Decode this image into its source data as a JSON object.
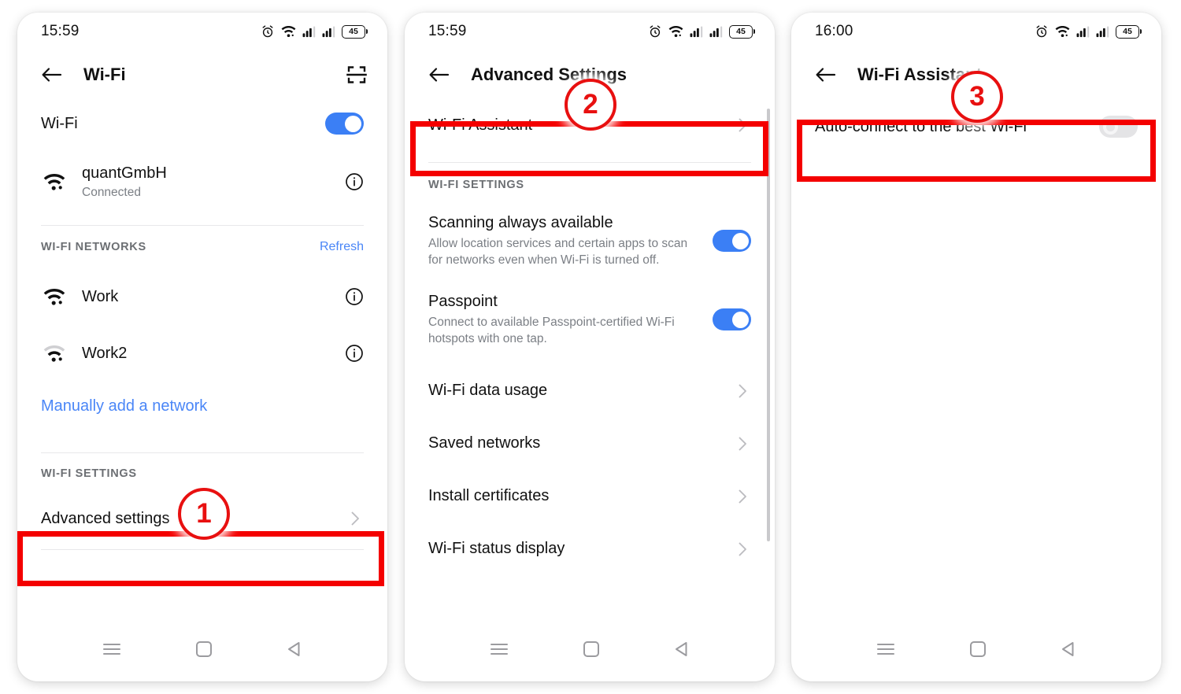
{
  "accent_blue": "#3b7ff5",
  "link_blue": "#4a86f7",
  "highlight_red": "#f40000",
  "panels": [
    {
      "status": {
        "time": "15:59",
        "battery": "45"
      },
      "appbar": {
        "title": "Wi-Fi",
        "back_icon": "arrow-left-icon",
        "action_icon": "qr-scan-icon"
      },
      "wifi_toggle_label": "Wi-Fi",
      "wifi_toggle_state": "on",
      "connected": {
        "ssid": "quantGmbH",
        "status": "Connected",
        "info_icon": "info-icon"
      },
      "networks_header": "WI-FI NETWORKS",
      "refresh_label": "Refresh",
      "networks": [
        {
          "ssid": "Work",
          "signal": "strong"
        },
        {
          "ssid": "Work2",
          "signal": "weak"
        }
      ],
      "manual_add_label": "Manually add a network",
      "settings_header": "WI-FI SETTINGS",
      "advanced_label": "Advanced settings"
    },
    {
      "status": {
        "time": "15:59",
        "battery": "45"
      },
      "appbar": {
        "title": "Advanced Settings",
        "back_icon": "arrow-left-icon"
      },
      "assistant_label": "Wi-Fi Assistant",
      "settings_header": "WI-FI SETTINGS",
      "items": [
        {
          "title": "Scanning always available",
          "desc": "Allow location services and certain apps to scan for networks even when Wi-Fi is turned off.",
          "toggle": "on"
        },
        {
          "title": "Passpoint",
          "desc": "Connect to available Passpoint-certified Wi-Fi hotspots with one tap.",
          "toggle": "on"
        }
      ],
      "links": [
        "Wi-Fi data usage",
        "Saved networks",
        "Install certificates",
        "Wi-Fi status display"
      ]
    },
    {
      "status": {
        "time": "16:00",
        "battery": "45"
      },
      "appbar": {
        "title": "Wi-Fi Assistant",
        "back_icon": "arrow-left-icon"
      },
      "auto_connect_label": "Auto-connect to the best Wi-Fi",
      "auto_connect_state": "off"
    }
  ],
  "badges": [
    {
      "number": "1"
    },
    {
      "number": "2"
    },
    {
      "number": "3"
    }
  ],
  "navbar": {
    "recents_icon": "hamburger-icon",
    "home_icon": "square-icon",
    "back_icon": "triangle-back-icon"
  }
}
